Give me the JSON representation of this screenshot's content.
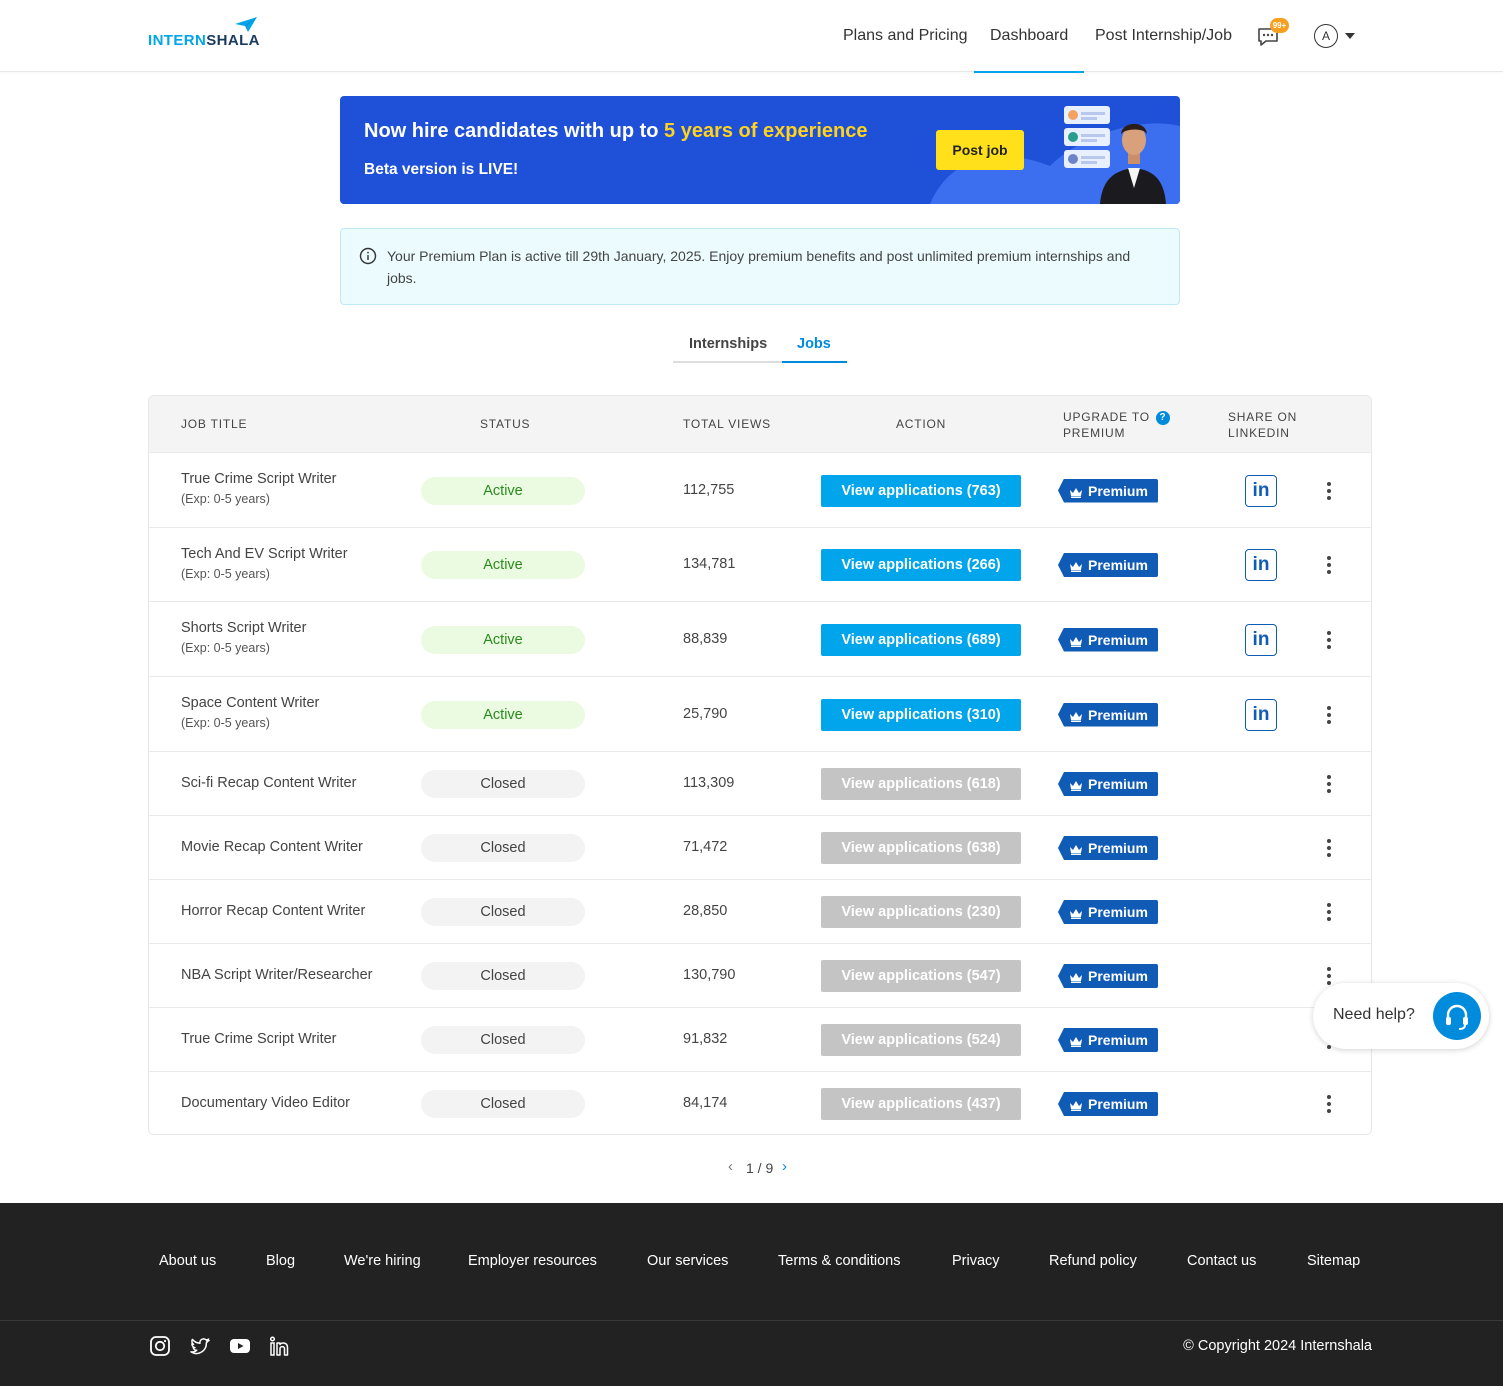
{
  "header": {
    "logo": {
      "part1": "INTERN",
      "part2": "SHALA"
    },
    "nav": {
      "plans": "Plans and Pricing",
      "dashboard": "Dashboard",
      "post": "Post Internship/Job"
    },
    "chat_badge": "99+",
    "avatar_initial": "A"
  },
  "banner": {
    "title_prefix": "Now hire candidates with up to ",
    "title_highlight": "5 years of experience",
    "subtitle": "Beta version is LIVE!",
    "button": "Post job"
  },
  "notice": {
    "text": "Your Premium Plan is active till 29th January, 2025. Enjoy premium benefits and post unlimited premium internships and jobs."
  },
  "tabs": {
    "internships": "Internships",
    "jobs": "Jobs"
  },
  "table": {
    "headers": {
      "job_title": "Job title",
      "status": "Status",
      "total_views": "Total views",
      "action": "Action",
      "upgrade_line1": "Upgrade to",
      "upgrade_line2": "premium",
      "help_icon": "?",
      "share_line1": "Share on",
      "share_line2": "LinkedIn"
    },
    "premium_label": "Premium",
    "linkedin_label": "in",
    "rows": [
      {
        "title": "True Crime Script Writer",
        "exp": "(Exp: 0-5 years)",
        "status": "Active",
        "views": "112,755",
        "action": "View applications (763)"
      },
      {
        "title": "Tech And EV Script Writer",
        "exp": "(Exp: 0-5 years)",
        "status": "Active",
        "views": "134,781",
        "action": "View applications (266)"
      },
      {
        "title": "Shorts Script Writer",
        "exp": "(Exp: 0-5 years)",
        "status": "Active",
        "views": "88,839",
        "action": "View applications (689)"
      },
      {
        "title": "Space Content Writer",
        "exp": "(Exp: 0-5 years)",
        "status": "Active",
        "views": "25,790",
        "action": "View applications (310)"
      },
      {
        "title": "Sci-fi Recap Content Writer",
        "exp": "",
        "status": "Closed",
        "views": "113,309",
        "action": "View applications (618)"
      },
      {
        "title": "Movie Recap Content Writer",
        "exp": "",
        "status": "Closed",
        "views": "71,472",
        "action": "View applications (638)"
      },
      {
        "title": "Horror Recap Content Writer",
        "exp": "",
        "status": "Closed",
        "views": "28,850",
        "action": "View applications (230)"
      },
      {
        "title": "NBA Script Writer/Researcher",
        "exp": "",
        "status": "Closed",
        "views": "130,790",
        "action": "View applications (547)"
      },
      {
        "title": "True Crime Script Writer",
        "exp": "",
        "status": "Closed",
        "views": "91,832",
        "action": "View applications (524)"
      },
      {
        "title": "Documentary Video Editor",
        "exp": "",
        "status": "Closed",
        "views": "84,174",
        "action": "View applications (437)"
      }
    ]
  },
  "pagination": {
    "text": "1 / 9",
    "prev": "‹",
    "next": "›"
  },
  "help": {
    "label": "Need help?"
  },
  "footer": {
    "links": [
      "About us",
      "Blog",
      "We're hiring",
      "Employer resources",
      "Our services",
      "Terms & conditions",
      "Privacy",
      "Refund policy",
      "Contact us",
      "Sitemap"
    ],
    "social": [
      "instagram-icon",
      "twitter-icon",
      "youtube-icon",
      "linkedin-icon"
    ],
    "copyright": "© Copyright 2024 Internshala"
  },
  "colors": {
    "brand": "#00a5ec",
    "premium": "#0f5bb5",
    "banner": "#1e50d8",
    "highlight": "#ffd21f"
  }
}
